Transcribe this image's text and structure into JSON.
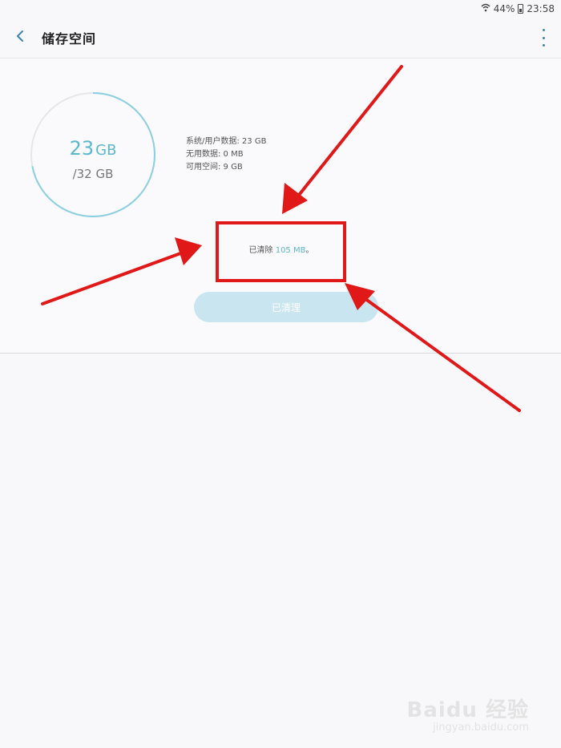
{
  "status_bar": {
    "battery": "44%",
    "time": "23:58"
  },
  "header": {
    "title": "储存空间",
    "back_icon": "chevron-left-icon",
    "more_icon": "more-vert-icon"
  },
  "storage": {
    "used_value": "23",
    "used_unit": "GB",
    "total": "/32 GB",
    "used_fraction": 0.72,
    "ring_color": "#8ccfe0"
  },
  "stats": [
    {
      "label": "系统/用户数据: 23 GB"
    },
    {
      "label": "无用数据: 0 MB"
    },
    {
      "label": "可用空间: 9 GB"
    }
  ],
  "cleared": {
    "prefix": "已清除 ",
    "amount": "105 MB",
    "suffix": "。"
  },
  "cleaned_button": {
    "label": "已清理"
  },
  "annotation_color": "#e01818",
  "watermark": {
    "logo": "Baidu 经验",
    "url": "jingyan.baidu.com"
  }
}
